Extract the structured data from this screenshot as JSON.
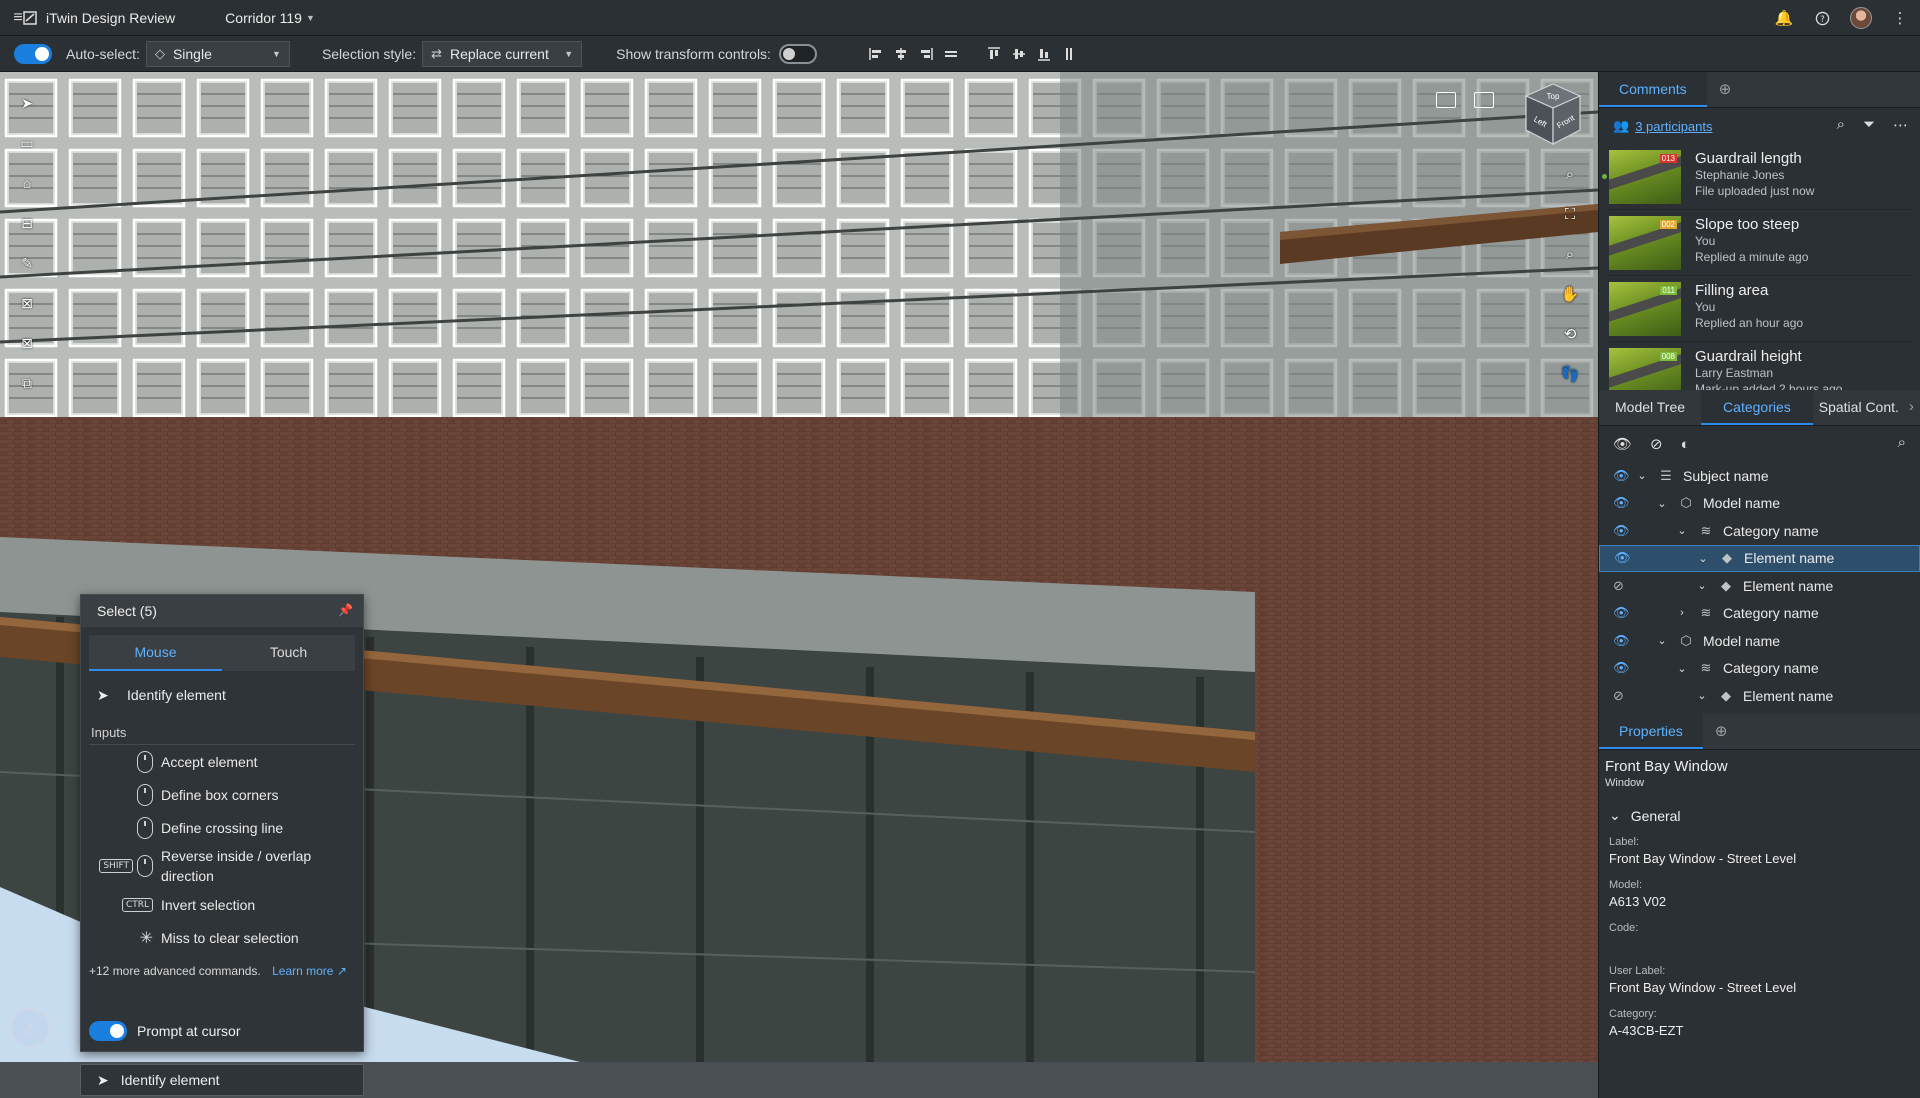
{
  "titlebar": {
    "app_name": "iTwin Design Review",
    "project_name": "Corridor 119"
  },
  "toolbar": {
    "auto_select_label": "Auto-select:",
    "auto_select_value": "Single",
    "selection_style_label": "Selection style:",
    "selection_style_value": "Replace current",
    "transform_label": "Show transform controls:"
  },
  "viewcube": {
    "top": "Top",
    "left": "Left",
    "front": "Front"
  },
  "select_panel": {
    "title": "Select  (5)",
    "tabs": [
      "Mouse",
      "Touch"
    ],
    "identify": "Identify element",
    "inputs_header": "Inputs",
    "inputs": [
      {
        "key": "",
        "label": "Accept element"
      },
      {
        "key": "",
        "label": "Define box corners"
      },
      {
        "key": "",
        "label": "Define crossing line"
      },
      {
        "key": "SHIFT",
        "label": "Reverse inside / overlap direction"
      },
      {
        "key": "CTRL",
        "label": "Invert selection"
      },
      {
        "key": "",
        "label": "Miss to clear selection"
      }
    ],
    "more_text": "+12 more advanced commands.",
    "learn_more": "Learn more",
    "prompt_label": "Prompt at cursor"
  },
  "status": {
    "identify": "Identify element"
  },
  "comments": {
    "tab": "Comments",
    "participants": "3 participants",
    "items": [
      {
        "title": "Guardrail length",
        "author": "Stephanie Jones",
        "time": "File uploaded just now",
        "tag": "013",
        "tag_color": "#d9342b"
      },
      {
        "title": "Slope too steep",
        "author": "You",
        "time": "Replied a minute ago",
        "tag": "002",
        "tag_color": "#e0a82e"
      },
      {
        "title": "Filling area",
        "author": "You",
        "time": "Replied an hour ago",
        "tag": "011",
        "tag_color": "#7dbb3a"
      },
      {
        "title": "Guardrail height",
        "author": "Larry Eastman",
        "time": "Mark-up added 2 hours ago",
        "tag": "008",
        "tag_color": "#7dbb3a"
      }
    ]
  },
  "tree": {
    "tabs": [
      "Model Tree",
      "Categories",
      "Spatial Cont."
    ],
    "rows": [
      {
        "label": "Subject name",
        "level": 0,
        "hidden": false,
        "expanded": true,
        "icon": "list-icon"
      },
      {
        "label": "Model name",
        "level": 1,
        "hidden": false,
        "expanded": true,
        "icon": "cube-icon"
      },
      {
        "label": "Category name",
        "level": 2,
        "hidden": false,
        "expanded": true,
        "icon": "layers-icon"
      },
      {
        "label": "Element name",
        "level": 3,
        "hidden": false,
        "expanded": true,
        "icon": "diamond-icon",
        "selected": true
      },
      {
        "label": "Element name",
        "level": 3,
        "hidden": true,
        "expanded": true,
        "icon": "diamond-icon"
      },
      {
        "label": "Category name",
        "level": 2,
        "hidden": false,
        "expanded": false,
        "icon": "layers-icon"
      },
      {
        "label": "Model name",
        "level": 1,
        "hidden": false,
        "expanded": true,
        "icon": "cube-icon"
      },
      {
        "label": "Category name",
        "level": 2,
        "hidden": false,
        "expanded": true,
        "icon": "layers-icon"
      },
      {
        "label": "Element name",
        "level": 3,
        "hidden": true,
        "expanded": true,
        "icon": "diamond-icon"
      }
    ]
  },
  "properties": {
    "tab": "Properties",
    "title": "Front Bay Window",
    "subtitle": "Window",
    "group": "General",
    "items": [
      {
        "key": "Label:",
        "value": "Front Bay Window - Street Level"
      },
      {
        "key": "Model:",
        "value": "A613 V02"
      },
      {
        "key": "Code:",
        "value": ""
      },
      {
        "key": "User Label:",
        "value": "Front Bay Window - Street Level"
      },
      {
        "key": "Category:",
        "value": "A-43CB-EZT"
      }
    ]
  },
  "colors": {
    "accent": "#2f8ceb",
    "link": "#5fb1ff",
    "panel": "#2b3034"
  }
}
